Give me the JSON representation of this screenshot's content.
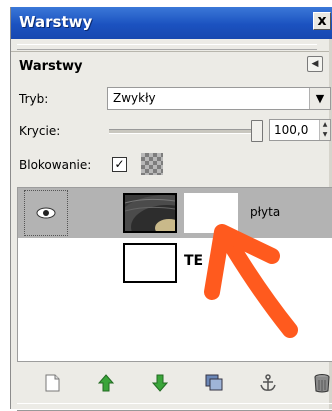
{
  "window": {
    "title": "Warstwy",
    "close_glyph": "x"
  },
  "panel": {
    "header": "Warstwy",
    "mode_label": "Tryb:",
    "mode_value": "Zwykły",
    "opacity_label": "Krycie:",
    "opacity_value": "100,0",
    "opacity_level": 100,
    "lock_label": "Blokowanie:",
    "lock_checked": true
  },
  "layers": [
    {
      "name": "płyta",
      "selected": true,
      "visible": true,
      "has_mask": true
    },
    {
      "name": "TE",
      "selected": false,
      "visible": false,
      "has_mask": false
    }
  ],
  "toolbar": {
    "icons": [
      "new-layer-icon",
      "raise-layer-icon",
      "lower-layer-icon",
      "duplicate-layer-icon",
      "anchor-layer-icon",
      "delete-layer-icon"
    ]
  },
  "colors": {
    "titlebar": "#1b52c0",
    "annotation_arrow": "#ff5a1e",
    "raise_green": "#3aa53a"
  }
}
